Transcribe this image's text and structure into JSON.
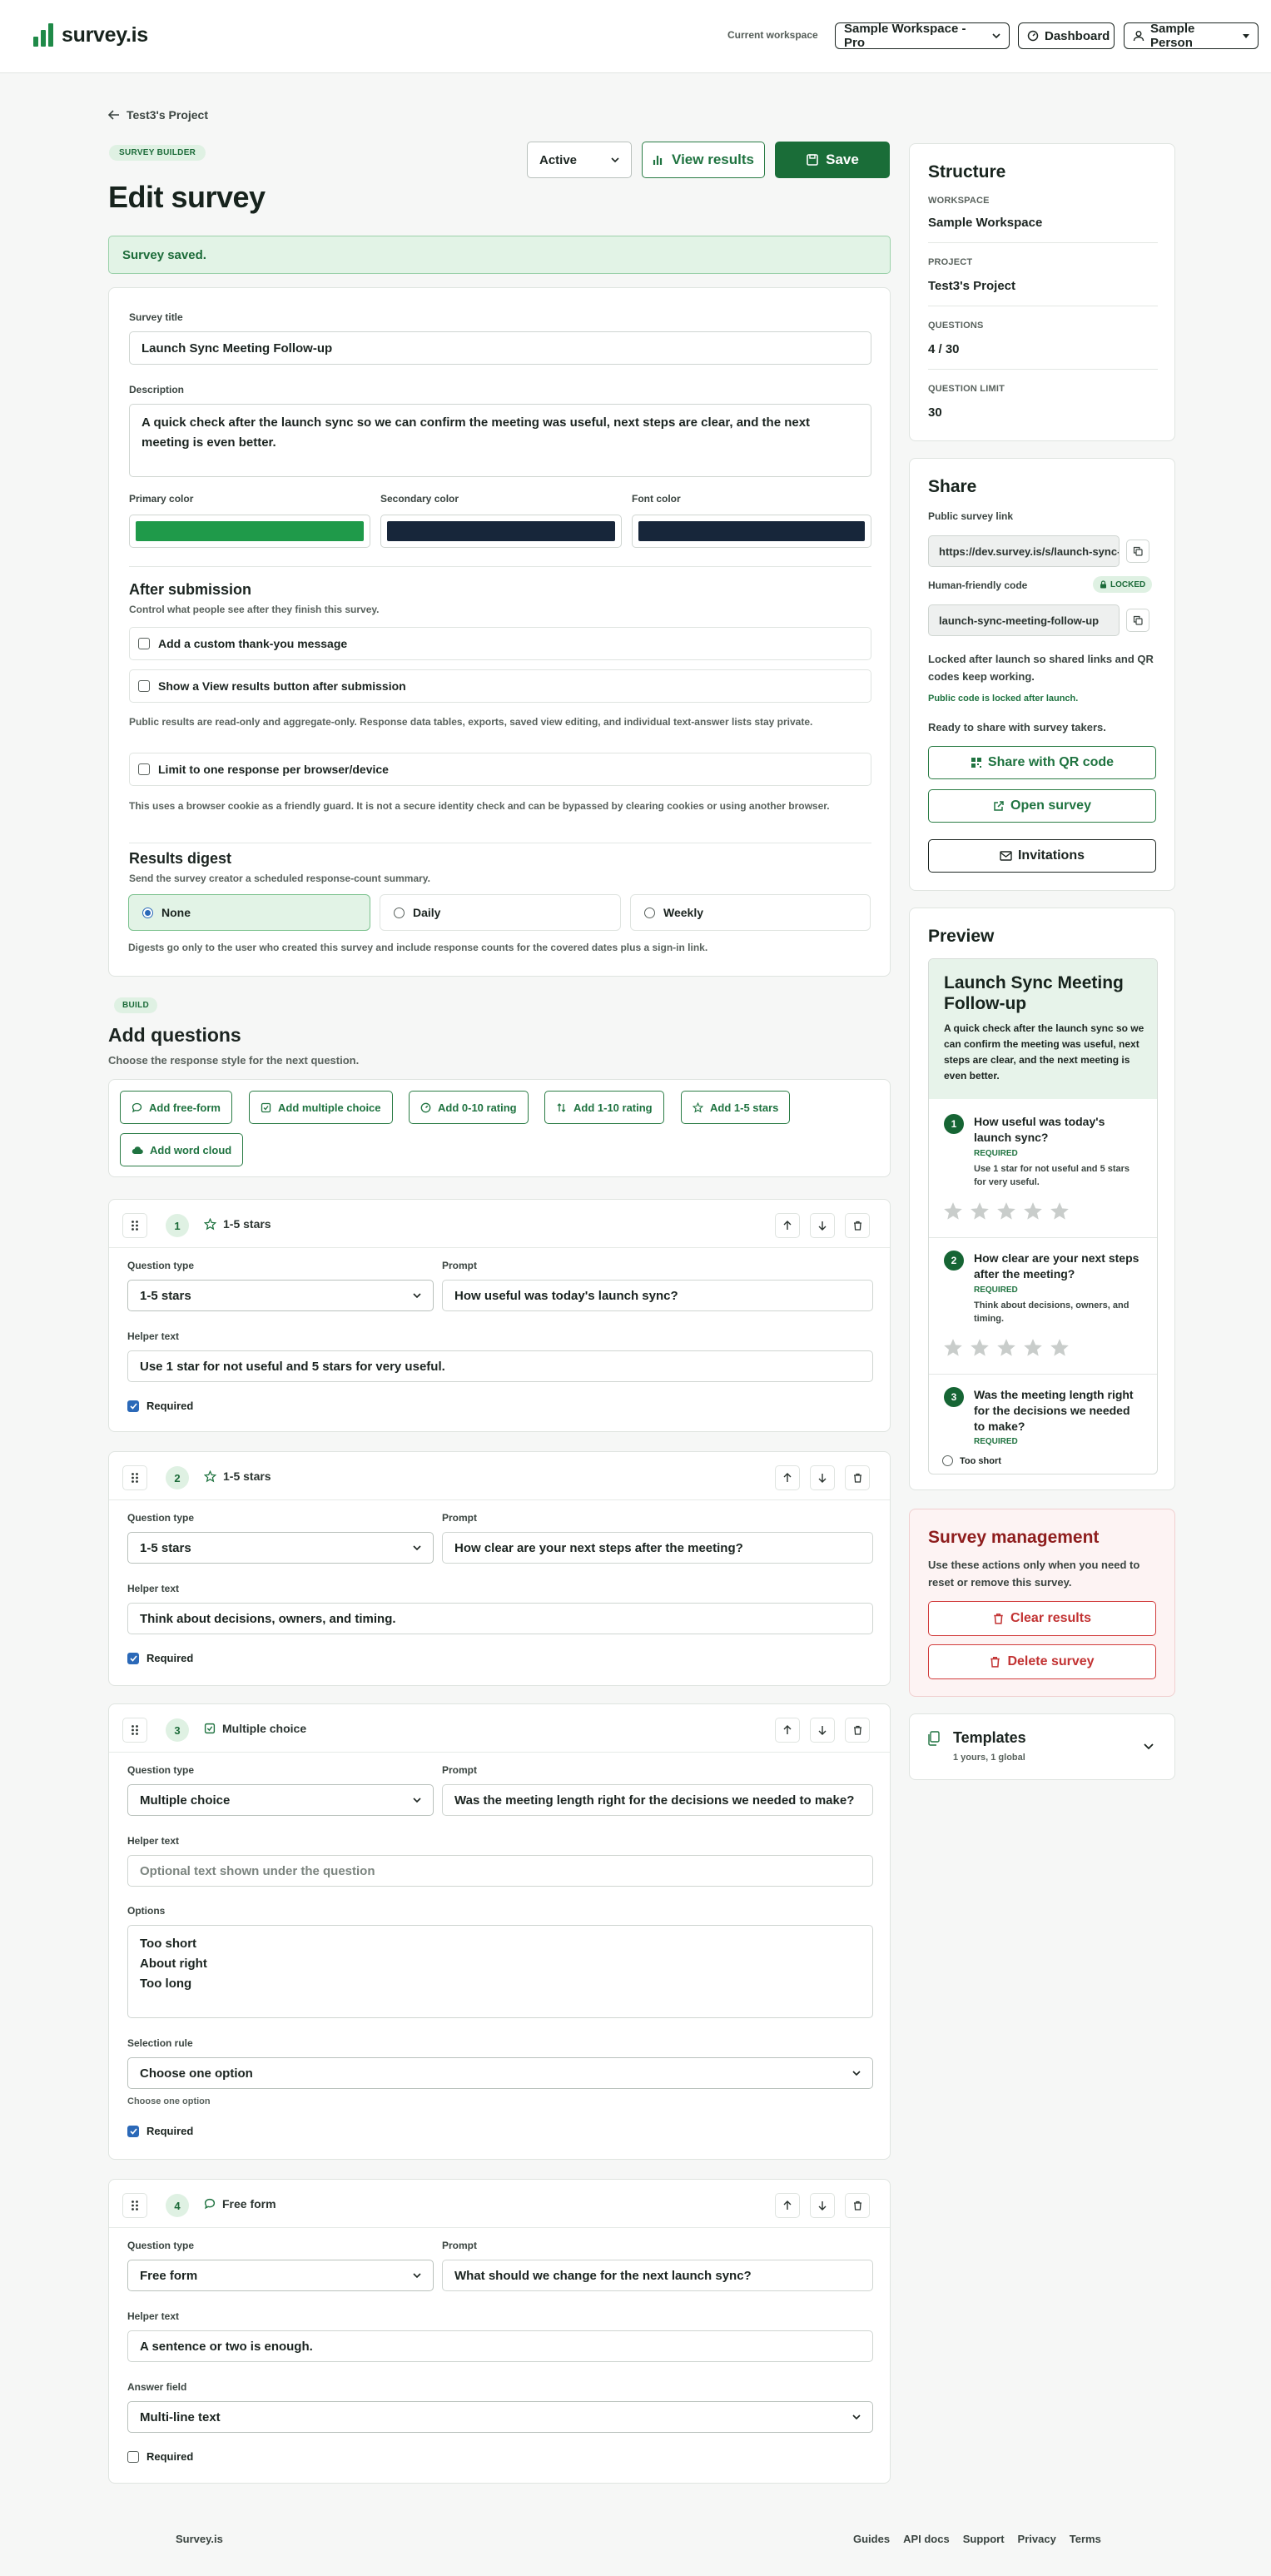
{
  "header": {
    "logo_text": "survey.is",
    "workspace_label": "Current workspace",
    "workspace_value": "Sample Workspace - Pro",
    "dashboard_label": "Dashboard",
    "user_label": "Sample Person"
  },
  "page": {
    "back_link": "Test3's Project",
    "pill": "SURVEY BUILDER",
    "title": "Edit survey",
    "status_value": "Active",
    "view_results_label": "View results",
    "save_label": "Save",
    "alert": "Survey saved."
  },
  "form": {
    "survey_title_label": "Survey title",
    "survey_title_value": "Launch Sync Meeting Follow-up",
    "description_label": "Description",
    "description_value": "A quick check after the launch sync so we can confirm the meeting was useful, next steps are clear, and the next meeting is even better.",
    "primary_color_label": "Primary color",
    "secondary_color_label": "Secondary color",
    "font_color_label": "Font color",
    "after_heading": "After submission",
    "after_sub": "Control what people see after they finish this survey.",
    "custom_thanks_label": "Add a custom thank-you message",
    "view_results_btn_label": "Show a View results button after submission",
    "public_note": "Public results are read-only and aggregate-only. Response data tables, exports, saved view editing, and individual text-answer lists stay private.",
    "limit_label": "Limit to one response per browser/device",
    "cookie_note": "This uses a browser cookie as a friendly guard. It is not a secure identity check and can be bypassed by clearing cookies or using another browser.",
    "digest_heading": "Results digest",
    "digest_sub": "Send the survey creator a scheduled response-count summary.",
    "digest_none": "None",
    "digest_daily": "Daily",
    "digest_weekly": "Weekly",
    "digest_note": "Digests go only to the user who created this survey and include response counts for the covered dates plus a sign-in link."
  },
  "colors": {
    "primary": "#1f9a4a",
    "secondary": "#17263a",
    "font": "#17263a",
    "accent": "#1f7340"
  },
  "build": {
    "pill": "BUILD",
    "heading": "Add questions",
    "sub": "Choose the response style for the next question.",
    "buttons": [
      "Add free-form",
      "Add multiple choice",
      "Add 0-10 rating",
      "Add 1-10 rating",
      "Add 1-5 stars",
      "Add word cloud"
    ]
  },
  "q_labels": {
    "question_type": "Question type",
    "prompt": "Prompt",
    "helper": "Helper text",
    "required": "Required",
    "options": "Options",
    "selection_rule": "Selection rule",
    "answer_field": "Answer field"
  },
  "questions": [
    {
      "num": "1",
      "type": "1-5 stars",
      "prompt": "How useful was today's launch sync?",
      "helper": "Use 1 star for not useful and 5 stars for very useful."
    },
    {
      "num": "2",
      "type": "1-5 stars",
      "prompt": "How clear are your next steps after the meeting?",
      "helper": "Think about decisions, owners, and timing."
    },
    {
      "num": "3",
      "type": "Multiple choice",
      "prompt": "Was the meeting length right for the decisions we needed to make?",
      "helper_placeholder": "Optional text shown under the question",
      "options": [
        "Too short",
        "About right",
        "Too long"
      ],
      "selection_rule": "Choose one option",
      "selection_hint": "Choose one option"
    },
    {
      "num": "4",
      "type": "Free form",
      "prompt": "What should we change for the next launch sync?",
      "helper": "A sentence or two is enough.",
      "answer_field": "Multi-line text"
    }
  ],
  "structure": {
    "heading": "Structure",
    "workspace_k": "WORKSPACE",
    "workspace_v": "Sample Workspace",
    "project_k": "PROJECT",
    "project_v": "Test3's Project",
    "questions_k": "QUESTIONS",
    "questions_v": "4 / 30",
    "limit_k": "QUESTION LIMIT",
    "limit_v": "30"
  },
  "share": {
    "heading": "Share",
    "link_label": "Public survey link",
    "link_value": "https://dev.survey.is/s/launch-sync-meeting-follow-up",
    "code_label": "Human-friendly code",
    "locked_badge": "LOCKED",
    "code_value": "launch-sync-meeting-follow-up",
    "locked_note": "Locked after launch so shared links and QR codes keep working.",
    "locked_green": "Public code is locked after launch.",
    "ready": "Ready to share with survey takers.",
    "qr_label": "Share with QR code",
    "open_label": "Open survey",
    "invitations_label": "Invitations"
  },
  "preview": {
    "heading": "Preview",
    "title": "Launch Sync Meeting Follow-up",
    "description": "A quick check after the launch sync so we can confirm the meeting was useful, next steps are clear, and the next meeting is even better.",
    "required_tag": "REQUIRED",
    "q1": "How useful was today's launch sync?",
    "q1_help": "Use 1 star for not useful and 5 stars for very useful.",
    "q2": "How clear are your next steps after the meeting?",
    "q2_help": "Think about decisions, owners, and timing.",
    "q3": "Was the meeting length right for the decisions we needed to make?",
    "q3_opt": "Too short"
  },
  "management": {
    "heading": "Survey management",
    "note": "Use these actions only when you need to reset or remove this survey.",
    "clear_label": "Clear results",
    "delete_label": "Delete survey"
  },
  "templates": {
    "heading": "Templates",
    "sub": "1 yours, 1 global"
  },
  "footer": {
    "brand": "Survey.is",
    "links": [
      "Guides",
      "API docs",
      "Support",
      "Privacy",
      "Terms"
    ]
  }
}
